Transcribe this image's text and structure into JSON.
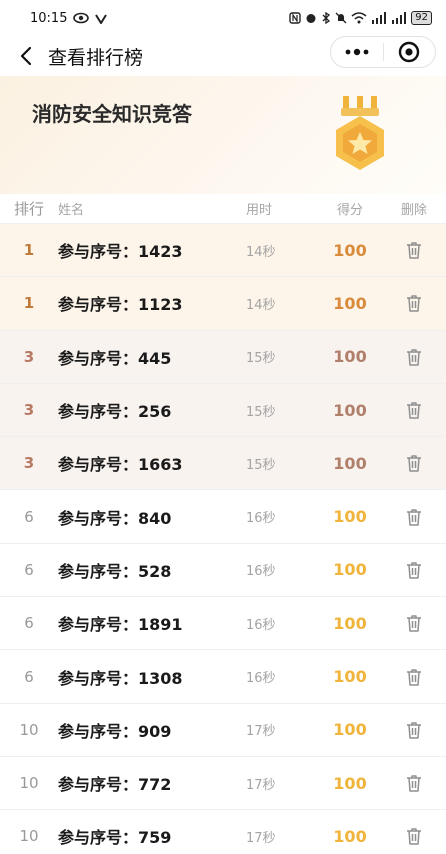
{
  "status": {
    "time": "10:15",
    "battery": "92"
  },
  "nav": {
    "title": "查看排行榜"
  },
  "banner": {
    "title": "消防安全知识竞答"
  },
  "table": {
    "headers": {
      "rank": "排行",
      "name": "姓名",
      "time": "用时",
      "score": "得分",
      "delete": "删除"
    },
    "rows": [
      {
        "rank": "1",
        "name": "参与序号：1423",
        "time": "14秒",
        "score": "100",
        "tier": "top1"
      },
      {
        "rank": "1",
        "name": "参与序号：1123",
        "time": "14秒",
        "score": "100",
        "tier": "top1"
      },
      {
        "rank": "3",
        "name": "参与序号：445",
        "time": "15秒",
        "score": "100",
        "tier": "top3"
      },
      {
        "rank": "3",
        "name": "参与序号：256",
        "time": "15秒",
        "score": "100",
        "tier": "top3"
      },
      {
        "rank": "3",
        "name": "参与序号：1663",
        "time": "15秒",
        "score": "100",
        "tier": "top3"
      },
      {
        "rank": "6",
        "name": "参与序号：840",
        "time": "16秒",
        "score": "100",
        "tier": "normal"
      },
      {
        "rank": "6",
        "name": "参与序号：528",
        "time": "16秒",
        "score": "100",
        "tier": "normal"
      },
      {
        "rank": "6",
        "name": "参与序号：1891",
        "time": "16秒",
        "score": "100",
        "tier": "normal"
      },
      {
        "rank": "6",
        "name": "参与序号：1308",
        "time": "16秒",
        "score": "100",
        "tier": "normal"
      },
      {
        "rank": "10",
        "name": "参与序号：909",
        "time": "17秒",
        "score": "100",
        "tier": "normal"
      },
      {
        "rank": "10",
        "name": "参与序号：772",
        "time": "17秒",
        "score": "100",
        "tier": "normal"
      },
      {
        "rank": "10",
        "name": "参与序号：759",
        "time": "17秒",
        "score": "100",
        "tier": "normal"
      }
    ]
  },
  "icons": {
    "back": "chevron-left-icon",
    "more": "more-dots-icon",
    "close": "target-circle-icon",
    "medal": "medal-star-icon",
    "delete": "trash-icon"
  },
  "colors": {
    "gold_score": "#f0b43a",
    "top1_bg": "#fdf5ea",
    "top3_bg": "#f9f3f0"
  }
}
